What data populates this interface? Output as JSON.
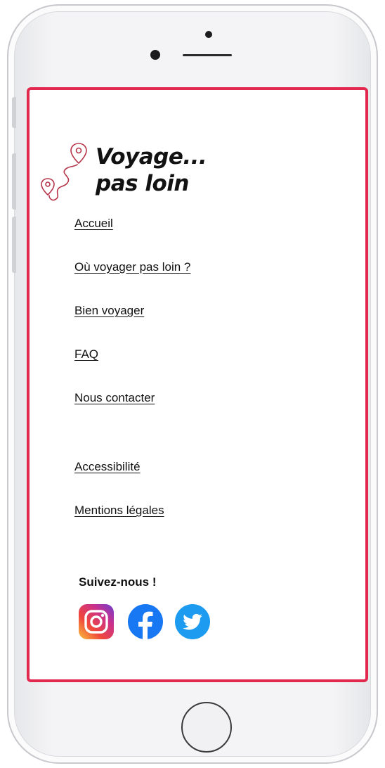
{
  "brand": {
    "line1": "Voyage...",
    "line2": "pas loin",
    "accent_color": "#b5364a",
    "frame_color": "#e2284e",
    "logo_icon": "map-route-pins"
  },
  "nav": {
    "items": [
      {
        "label": "Accueil"
      },
      {
        "label": "Où voyager pas loin ?"
      },
      {
        "label": "Bien voyager"
      },
      {
        "label": "FAQ"
      },
      {
        "label": "Nous contacter"
      }
    ],
    "secondary": [
      {
        "label": "Accessibilité"
      },
      {
        "label": "Mentions légales"
      }
    ]
  },
  "social": {
    "heading": "Suivez-nous !",
    "networks": [
      {
        "name": "instagram-icon"
      },
      {
        "name": "facebook-icon",
        "color": "#1877f2"
      },
      {
        "name": "twitter-icon",
        "color": "#1d9bf0"
      }
    ]
  }
}
